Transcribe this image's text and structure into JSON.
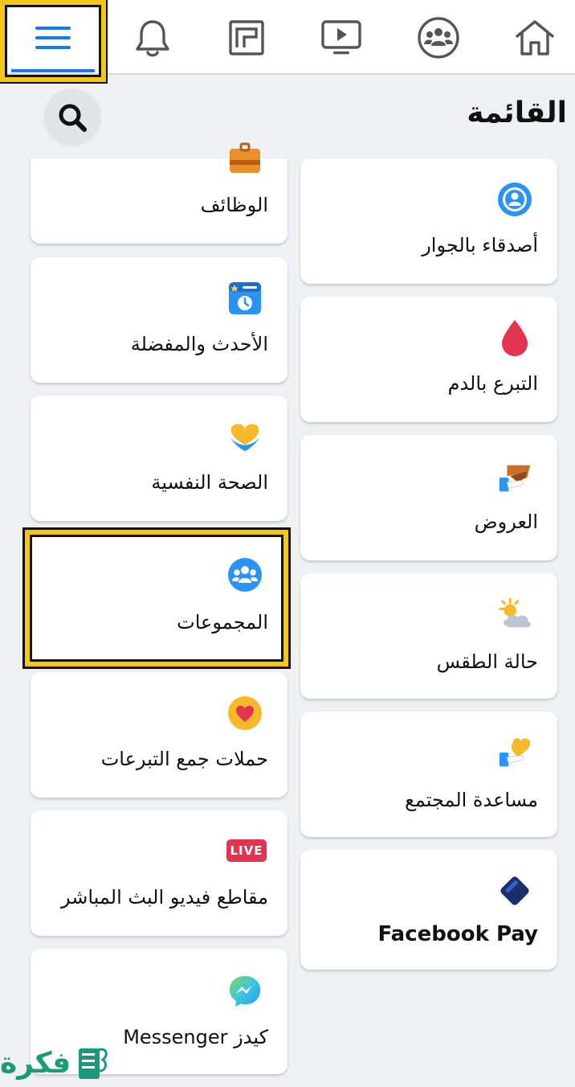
{
  "nav": {
    "items": [
      {
        "id": "menu",
        "icon": "menu-icon"
      },
      {
        "id": "notifications",
        "icon": "bell-icon"
      },
      {
        "id": "marketplace",
        "icon": "marketplace-icon"
      },
      {
        "id": "watch",
        "icon": "video-play-icon"
      },
      {
        "id": "groups",
        "icon": "groups-icon"
      },
      {
        "id": "home",
        "icon": "home-icon"
      }
    ],
    "highlight_color": "#f5c518",
    "accent_color": "#1877f2"
  },
  "header": {
    "title": "القائمة",
    "search_icon": "search-icon"
  },
  "shortcuts": {
    "right_column": [
      {
        "label": "أصدقاء بالجوار",
        "icon": "nearby-friends-icon"
      },
      {
        "label": "التبرع بالدم",
        "icon": "blood-drop-icon"
      },
      {
        "label": "العروض",
        "icon": "offers-icon"
      },
      {
        "label": "حالة الطقس",
        "icon": "weather-icon"
      },
      {
        "label": "مساعدة المجتمع",
        "icon": "community-help-icon"
      },
      {
        "label": "Facebook Pay",
        "icon": "facebook-pay-icon"
      }
    ],
    "left_column": [
      {
        "label": "الوظائف",
        "icon": "jobs-briefcase-icon"
      },
      {
        "label": "الأحدث والمفضلة",
        "icon": "most-recent-icon"
      },
      {
        "label": "الصحة النفسية",
        "icon": "emotional-health-icon"
      },
      {
        "label": "المجموعات",
        "icon": "groups-icon",
        "selected": true
      },
      {
        "label": "حملات جمع التبرعات",
        "icon": "fundraisers-heart-icon"
      },
      {
        "label": "مقاطع فيديو البث المباشر",
        "icon": "live-icon",
        "badge": "LIVE"
      },
      {
        "label": "كيدز Messenger",
        "icon": "messenger-kids-icon"
      }
    ]
  },
  "watermark": {
    "text": "فكرة",
    "color": "#1a9a7a"
  }
}
